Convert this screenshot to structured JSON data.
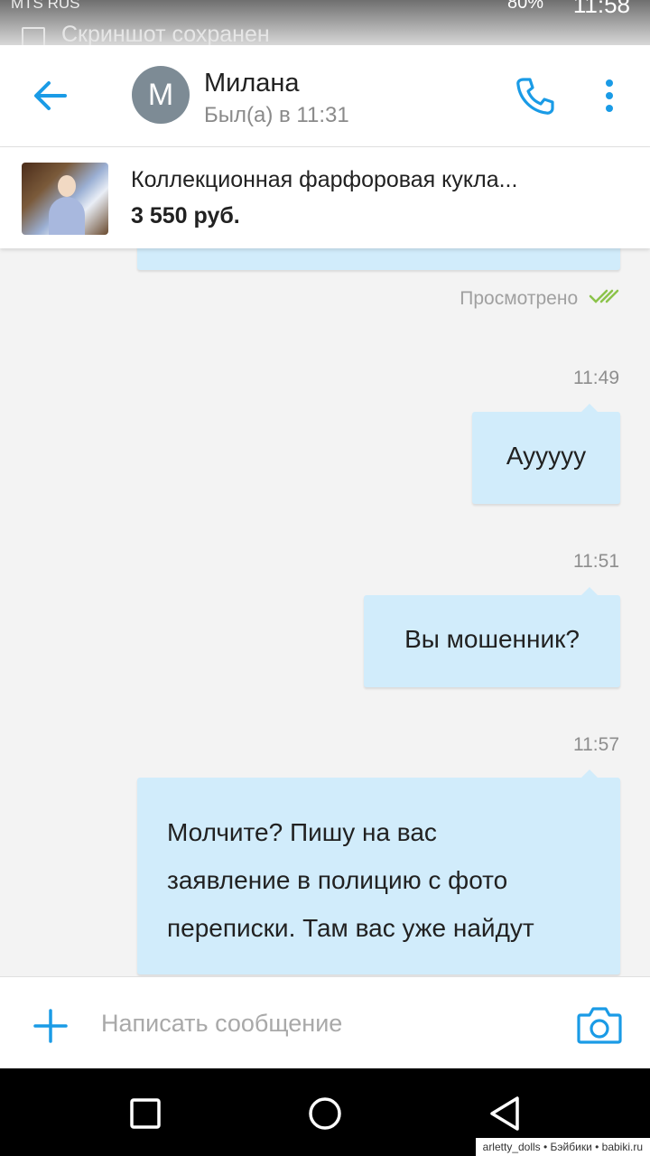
{
  "status_bar": {
    "carrier": "MTS RUS",
    "battery": "80%",
    "time": "11:58",
    "notification": "Скриншот сохранен"
  },
  "header": {
    "avatar_letter": "М",
    "contact_name": "Милана",
    "last_seen": "Был(а) в 11:31"
  },
  "listing": {
    "title": "Коллекционная фарфоровая кукла...",
    "price": "3 550 руб."
  },
  "chat": {
    "read_status": "Просмотрено",
    "messages": [
      {
        "time": "11:49",
        "text": "Ауууyy"
      },
      {
        "time": "11:51",
        "text": "Вы мошенник?"
      },
      {
        "time": "11:57",
        "lines": [
          "Молчите?  Пишу на вас",
          "заявление в полицию с фото",
          "переписки. Там вас уже найдут"
        ]
      }
    ]
  },
  "composer": {
    "placeholder": "Написать сообщение"
  },
  "watermark": "arletty_dolls • Бэйбики • babiki.ru",
  "colors": {
    "accent": "#1a9be6",
    "bubble": "#d1ecfb",
    "read_check": "#8bc34a",
    "avatar": "#7d8b95"
  },
  "icons": [
    "back-arrow-icon",
    "phone-icon",
    "more-vert-icon",
    "double-check-icon",
    "plus-icon",
    "camera-icon",
    "nav-recent-icon",
    "nav-home-icon",
    "nav-back-icon"
  ]
}
